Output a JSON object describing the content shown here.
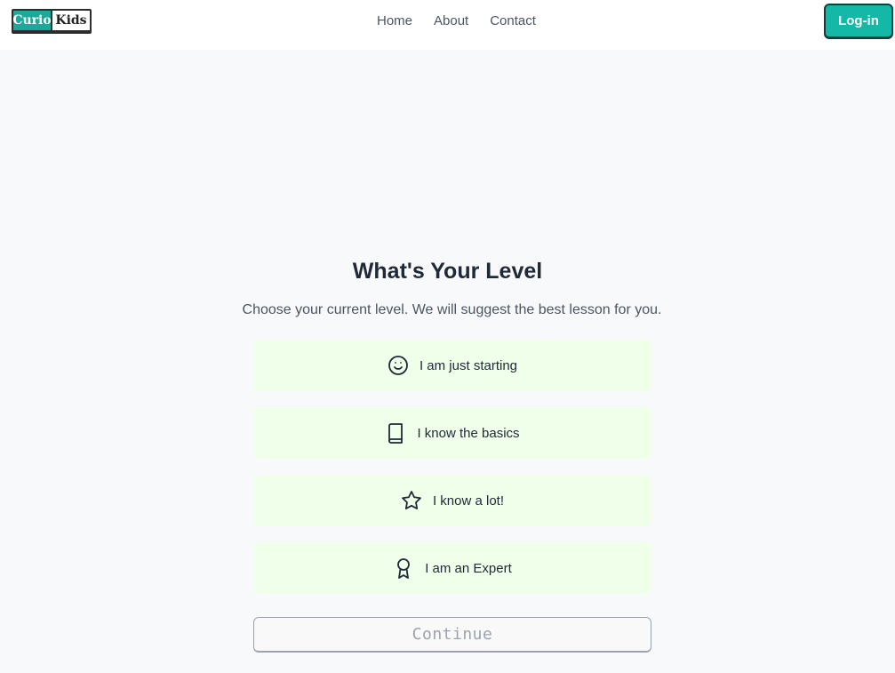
{
  "header": {
    "logo": {
      "left": "Curio",
      "right": "Kids"
    },
    "nav": [
      {
        "label": "Home"
      },
      {
        "label": "About"
      },
      {
        "label": "Contact"
      }
    ],
    "login_label": "Log-in"
  },
  "main": {
    "title": "What's Your Level",
    "subtitle": "Choose your current level. We will suggest the best lesson for you.",
    "options": [
      {
        "label": "I am just starting",
        "icon": "smile-icon"
      },
      {
        "label": "I know the basics",
        "icon": "book-icon"
      },
      {
        "label": "I know a lot!",
        "icon": "star-icon"
      },
      {
        "label": "I am an Expert",
        "icon": "award-icon"
      }
    ],
    "continue_label": "Continue"
  },
  "colors": {
    "accent": "#14b8a6",
    "option_bg": "#efffe9",
    "page_bg": "#f8f9fb"
  }
}
